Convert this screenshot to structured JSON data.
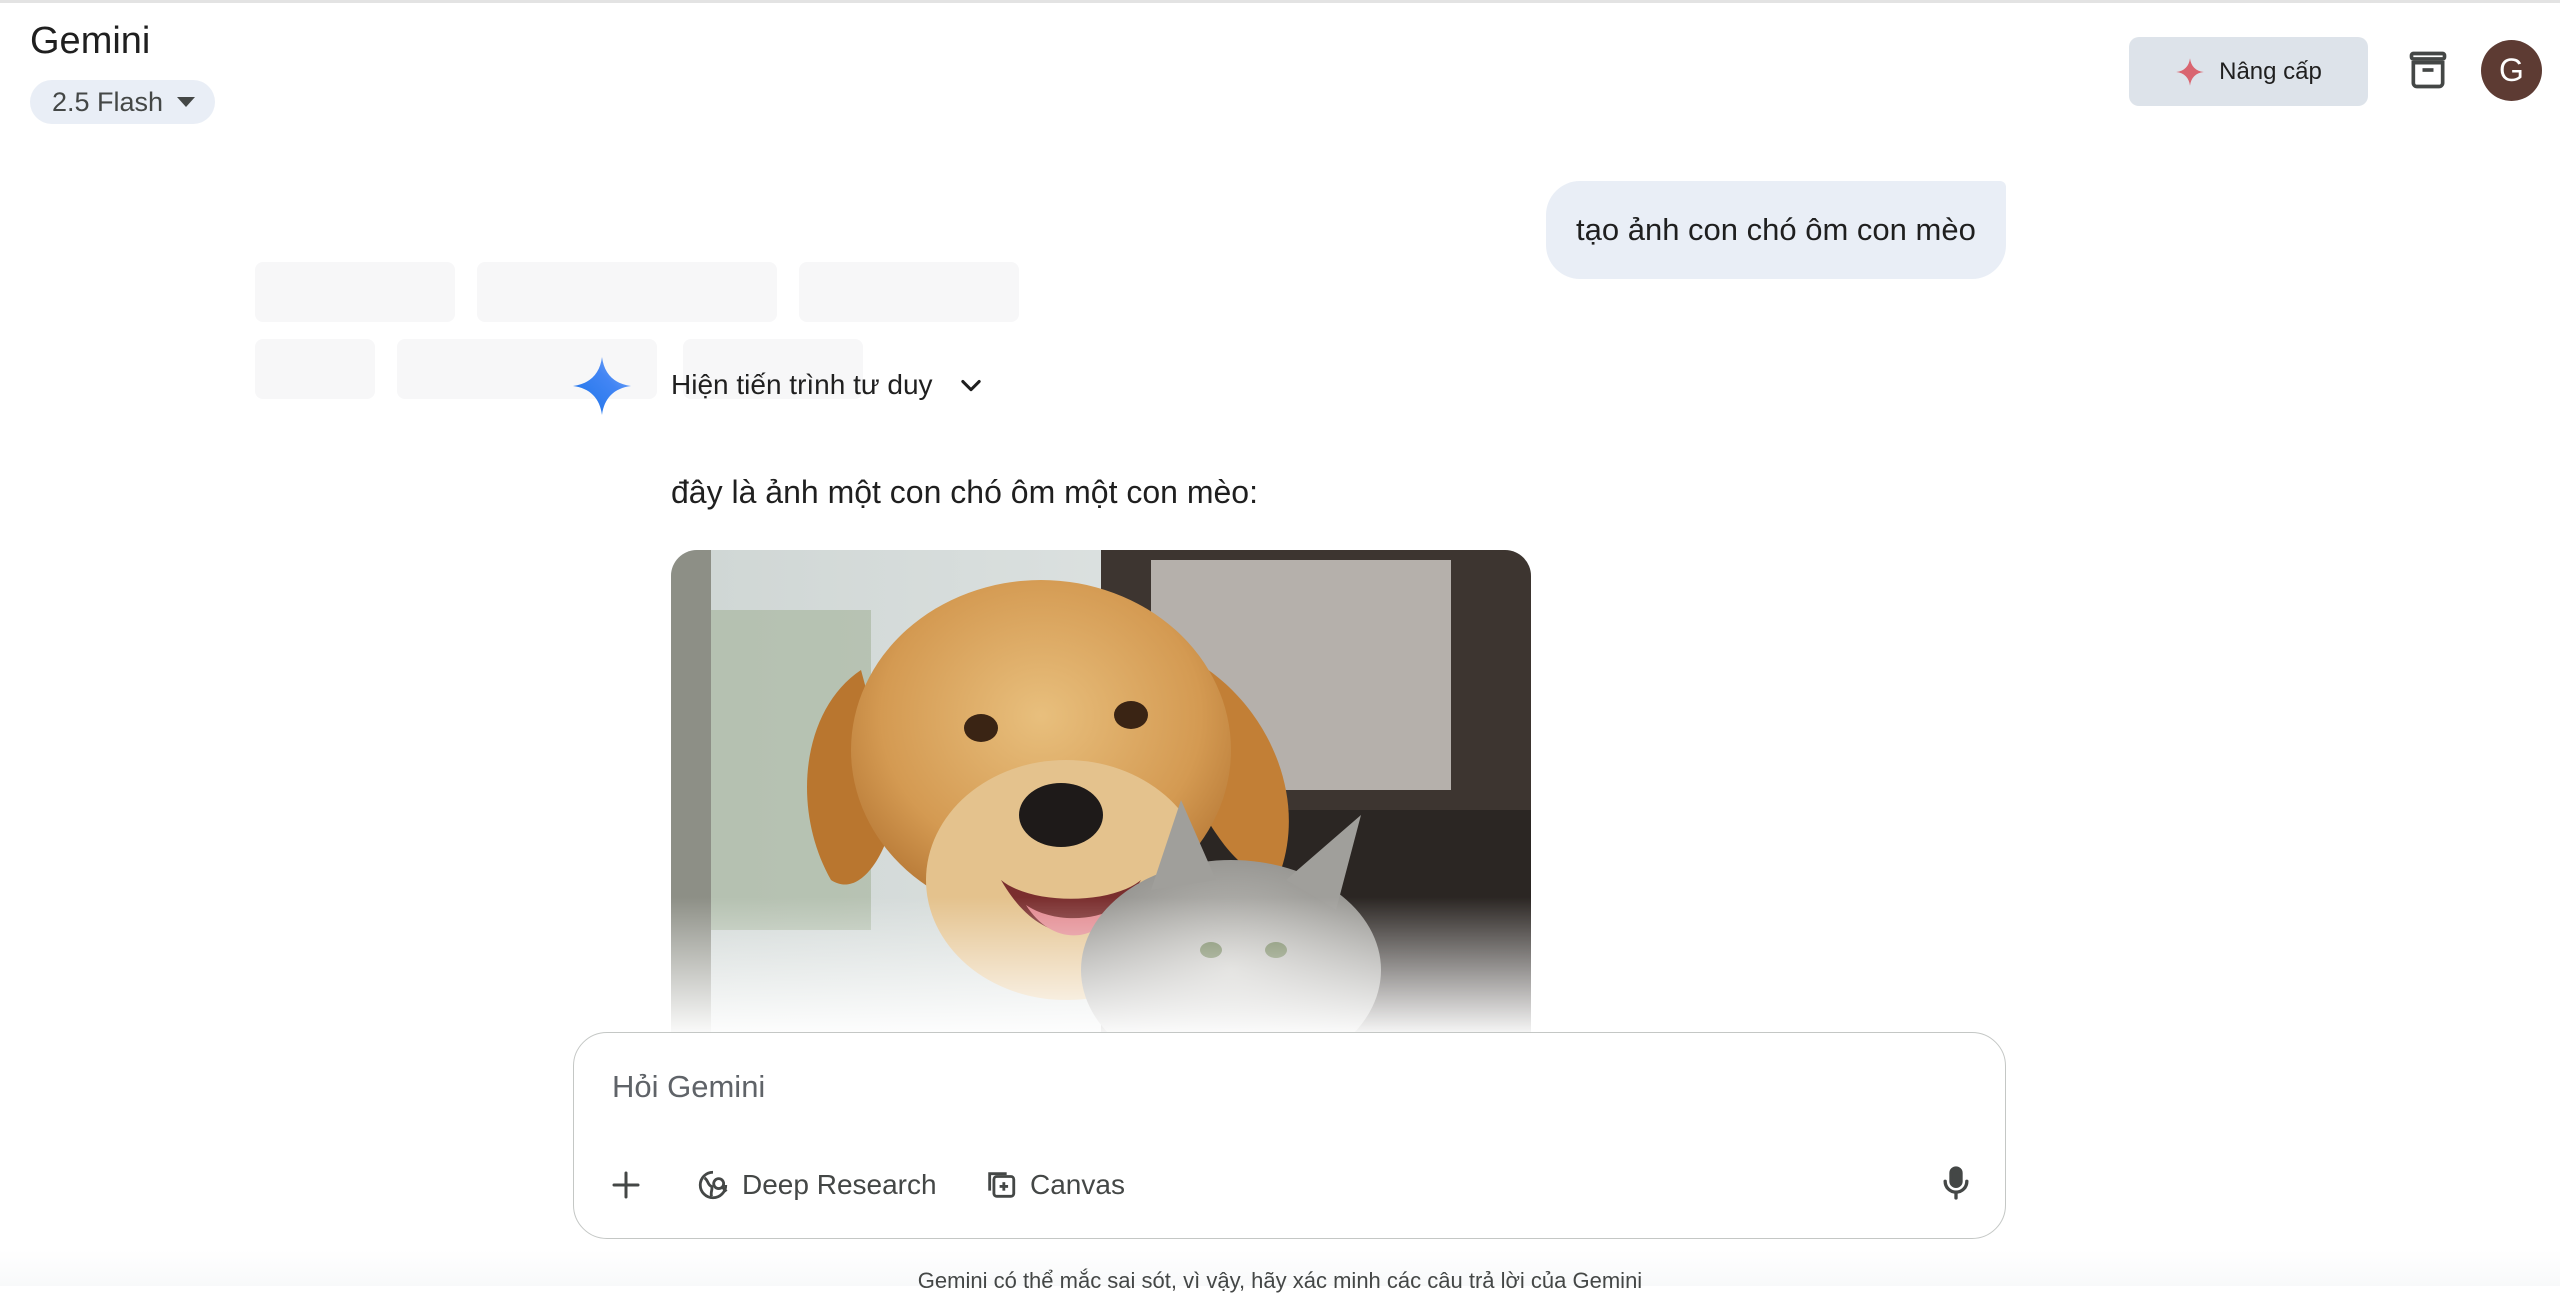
{
  "header": {
    "app_title": "Gemini",
    "model_label": "2.5 Flash",
    "upgrade_label": "Nâng cấp",
    "avatar_initial": "G"
  },
  "conversation": {
    "user_message": "tạo ảnh con chó ôm con mèo",
    "thinking_label": "Hiện tiến trình tư duy",
    "response_text": "đây là ảnh một con chó ôm một con mèo:",
    "image_subject": "golden retriever dog hugging a grey tabby cat"
  },
  "composer": {
    "placeholder": "Hỏi Gemini",
    "deep_research_label": "Deep Research",
    "canvas_label": "Canvas"
  },
  "footer": {
    "disclaimer": "Gemini có thể mắc sai sót, vì vậy, hãy xác minh các câu trả lời của Gemini"
  },
  "icons": {
    "model_caret": "caret-down-icon",
    "upgrade": "sparkle-icon",
    "archive": "archive-icon",
    "gemini": "gemini-star-icon",
    "thinking": "chevron-down-icon",
    "add": "plus-icon",
    "deep_research": "globe-search-icon",
    "canvas": "canvas-icon",
    "mic": "mic-icon"
  },
  "colors": {
    "bubble": "#e9eef6",
    "upgrade_bg": "#dde3ea",
    "avatar_bg": "#5d3b33",
    "sparkle": "#d96570",
    "gemini_blue": "#4285f4"
  }
}
